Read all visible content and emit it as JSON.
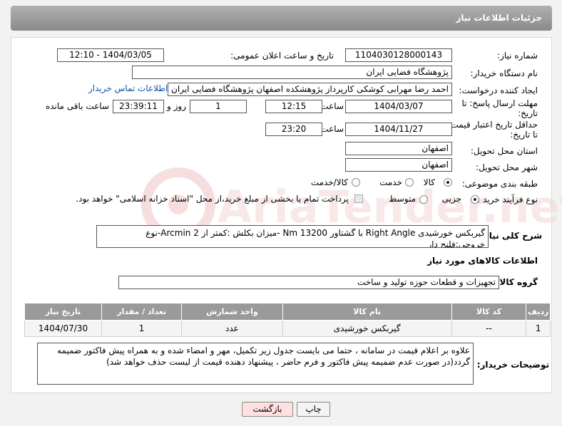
{
  "header": {
    "title": "جزئیات اطلاعات نیاز"
  },
  "fields": {
    "need_number_label": "شماره نیاز:",
    "need_number": "1104030128000143",
    "announce_label": "تاریخ و ساعت اعلان عمومی:",
    "announce_value": "1404/03/05 - 12:10",
    "buyer_org_label": "نام دستگاه خریدار:",
    "buyer_org": "پژوهشگاه فضایی ایران",
    "creator_label": "ایجاد کننده درخواست:",
    "creator": "احمد رضا مهرابی کوشکی کارپرداز پژوهشکده اصفهان پژوهشگاه فضایی ایران",
    "contact_link": "اطلاعات تماس خریدار",
    "deadline_label_1": "مهلت ارسال پاسخ: تا",
    "deadline_label_2": "تاریخ:",
    "deadline_date": "1404/03/07",
    "time_label": "ساعت",
    "deadline_time": "12:15",
    "days_value": "1",
    "days_label": "روز و",
    "remaining_value": "23:39:11",
    "remaining_label": "ساعت باقی مانده",
    "validity_label_1": "حداقل تاریخ اعتبار قیمت:",
    "validity_label_2": "تا تاریخ:",
    "validity_date": "1404/11/27",
    "validity_time": "23:20",
    "province_label": "استان محل تحویل:",
    "province": "اصفهان",
    "city_label": "شهر محل تحویل:",
    "city": "اصفهان",
    "category_label": "طبقه بندی موضوعی:",
    "category_goods": "کالا",
    "category_service": "خدمت",
    "category_both": "کالا/خدمت",
    "process_label": "نوع فرآیند خرید :",
    "process_minor": "جزیی",
    "process_medium": "متوسط",
    "payment_note": "پرداخت تمام یا بخشی از مبلغ خرید،از محل \"اسناد خزانه اسلامی\" خواهد بود.",
    "summary_label": "شرح کلی نیاز:",
    "summary": "گیربکس خورشیدی Right Angle با گشتاور 13200 Nm -میزان بکلش :کمتر از Arcmin 2-نوع خروجی:فلنج دار",
    "goods_info_title": "اطلاعات کالاهای مورد نیاز",
    "goods_group_label": "گروه کالا:",
    "goods_group": "تجهیزات و قطعات حوزه تولید و ساخت",
    "buyer_notes_label": "توضیحات خریدار:",
    "buyer_notes": "علاوه بر اعلام قیمت در سامانه ، حتما می بایست جدول زیر تکمیل، مهر و امضاء شده و به همراه پیش فاکتور ضمیمه گردد(در صورت عدم ضمیمه پیش فاکتور و فرم حاضر ، پیشنهاد دهنده قیمت از لیست حذف خواهد شد)"
  },
  "table": {
    "headers": [
      "ردیف",
      "کد کالا",
      "نام کالا",
      "واحد شمارش",
      "تعداد / مقدار",
      "تاریخ نیاز"
    ],
    "rows": [
      [
        "1",
        "--",
        "گیربکس خورشیدی",
        "عدد",
        "1",
        "1404/07/30"
      ]
    ]
  },
  "buttons": {
    "print": "چاپ",
    "back": "بازگشت"
  },
  "watermark": {
    "text": "AriaTender.net"
  },
  "colors": {
    "header": "#9a9a9a",
    "link": "#1155aa",
    "watermark": "#f3d6d6"
  }
}
